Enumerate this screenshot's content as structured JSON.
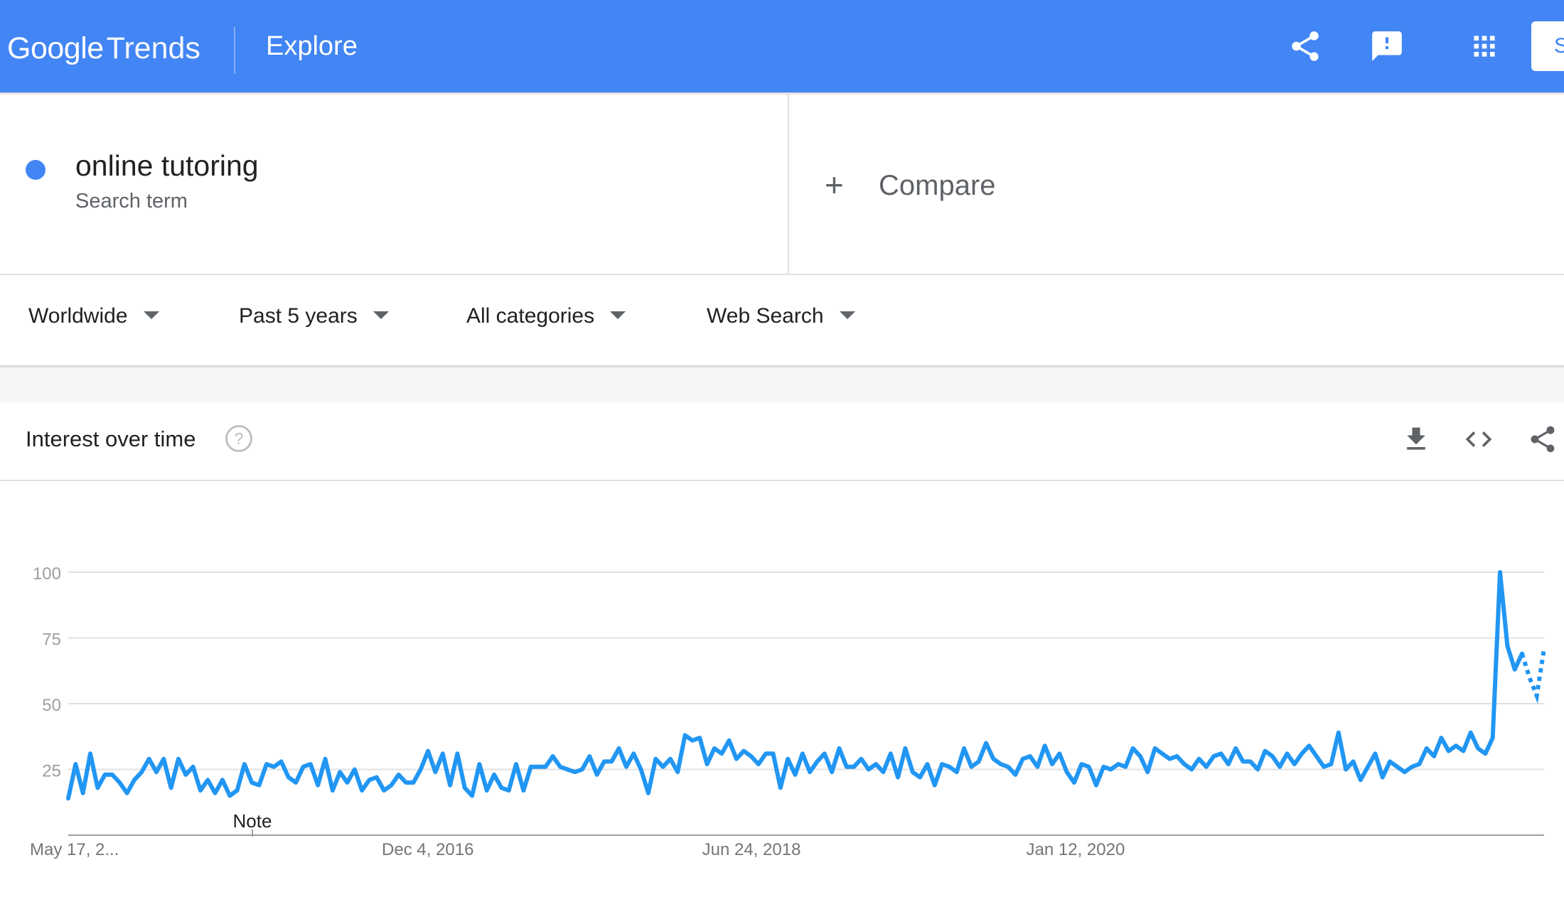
{
  "header": {
    "logo_google": "Google",
    "logo_trends": "Trends",
    "section": "Explore",
    "signin_label": "S",
    "accent_color": "#4285f4"
  },
  "icons": {
    "share": "share-icon",
    "feedback": "feedback-icon",
    "apps": "apps-grid-icon",
    "help": "help-icon",
    "download": "download-icon",
    "embed": "embed-code-icon",
    "chart_share": "share-icon"
  },
  "search_term": {
    "name": "online tutoring",
    "subtitle": "Search term",
    "color": "#4285f4"
  },
  "compare": {
    "label": "Compare"
  },
  "filters": {
    "region": "Worldwide",
    "time": "Past 5 years",
    "category": "All categories",
    "search_type": "Web Search"
  },
  "chart_card": {
    "title": "Interest over time"
  },
  "chart_data": {
    "type": "line",
    "title": "Interest over time",
    "xlabel": "",
    "ylabel": "",
    "ylim": [
      0,
      100
    ],
    "yticks": [
      25,
      50,
      75,
      100
    ],
    "xtick_labels": [
      "May 17, 2...",
      "Dec 4, 2016",
      "Jun 24, 2018",
      "Jan 12, 2020"
    ],
    "annotation": "Note",
    "grid": true,
    "line_color": "#2196f3",
    "partial_data_points": 3,
    "series": [
      {
        "values": [
          14,
          27,
          16,
          31,
          18,
          23,
          23,
          20,
          16,
          21,
          24,
          29,
          24,
          29,
          18,
          29,
          23,
          26,
          17,
          21,
          16,
          21,
          15,
          17,
          27,
          20,
          19,
          27,
          26,
          28,
          22,
          20,
          26,
          27,
          19,
          29,
          17,
          24,
          20,
          25,
          17,
          21,
          22,
          17,
          19,
          23,
          20,
          20,
          25,
          32,
          24,
          31,
          19,
          31,
          18,
          15,
          27,
          17,
          23,
          18,
          17,
          27,
          17,
          26,
          26,
          26,
          30,
          26,
          25,
          24,
          25,
          30,
          23,
          28,
          28,
          33,
          26,
          31,
          25,
          16,
          29,
          26,
          29,
          24,
          38,
          36,
          37,
          27,
          33,
          31,
          36,
          29,
          32,
          30,
          27,
          31,
          31,
          18,
          29,
          23,
          31,
          24,
          28,
          31,
          24,
          33,
          26,
          26,
          29,
          25,
          27,
          24,
          31,
          22,
          33,
          24,
          22,
          27,
          19,
          27,
          26,
          24,
          33,
          26,
          28,
          35,
          29,
          27,
          26,
          23,
          29,
          30,
          26,
          34,
          27,
          31,
          24,
          20,
          27,
          26,
          19,
          26,
          25,
          27,
          26,
          33,
          30,
          24,
          33,
          31,
          29,
          30,
          27,
          25,
          29,
          26,
          30,
          31,
          27,
          33,
          28,
          28,
          25,
          32,
          30,
          26,
          31,
          27,
          31,
          34,
          30,
          26,
          27,
          39,
          25,
          28,
          21,
          26,
          31,
          22,
          28,
          26,
          24,
          26,
          27,
          33,
          30,
          37,
          32,
          34,
          32,
          39,
          33,
          31,
          37,
          100,
          72,
          63,
          69,
          60,
          53,
          71
        ]
      }
    ]
  }
}
